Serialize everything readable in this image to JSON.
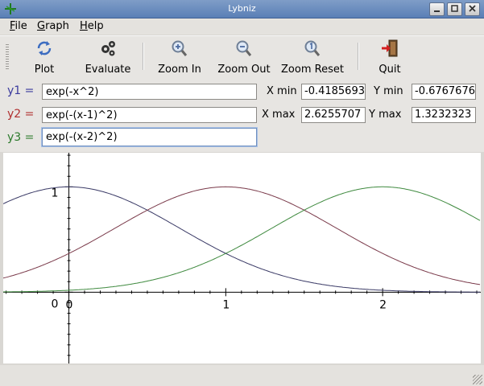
{
  "window": {
    "title": "Lybniz"
  },
  "menu": {
    "items": [
      {
        "label": "File",
        "underline": "F",
        "rest": "ile"
      },
      {
        "label": "Graph",
        "underline": "G",
        "rest": "raph"
      },
      {
        "label": "Help",
        "underline": "H",
        "rest": "elp"
      }
    ]
  },
  "toolbar": {
    "plot": "Plot",
    "evaluate": "Evaluate",
    "zoom_in": "Zoom In",
    "zoom_out": "Zoom Out",
    "zoom_reset": "Zoom Reset",
    "quit": "Quit"
  },
  "functions": [
    {
      "label": "y1 =",
      "value": "exp(-x^2)",
      "color": "#3b3b9e"
    },
    {
      "label": "y2 =",
      "value": "exp(-(x-1)^2)",
      "color": "#b02f2f"
    },
    {
      "label": "y3 =",
      "value": "exp(-(x-2)^2)",
      "color": "#2c7a2c"
    }
  ],
  "range": {
    "xmin_label": "X min",
    "xmin": "-0.4185693",
    "xmax_label": "X max",
    "xmax": "2.6255707",
    "ymin_label": "Y min",
    "ymin": "-0.6767676",
    "ymax_label": "Y max",
    "ymax": "1.3232323"
  },
  "chart_data": {
    "type": "line",
    "xlim": [
      -0.4185693,
      2.6255707
    ],
    "ylim": [
      -0.6767676,
      1.3232323
    ],
    "x_ticks": [
      "0",
      "1",
      "2"
    ],
    "y_ticks": [
      "1"
    ],
    "origin_label": "0",
    "series": [
      {
        "expr": "exp(-x^2)",
        "center": 0,
        "color": "#3a3a66"
      },
      {
        "expr": "exp(-(x-1)^2)",
        "center": 1,
        "color": "#7a3a4a"
      },
      {
        "expr": "exp(-(x-2)^2)",
        "center": 2,
        "color": "#3f8a3f"
      }
    ]
  }
}
